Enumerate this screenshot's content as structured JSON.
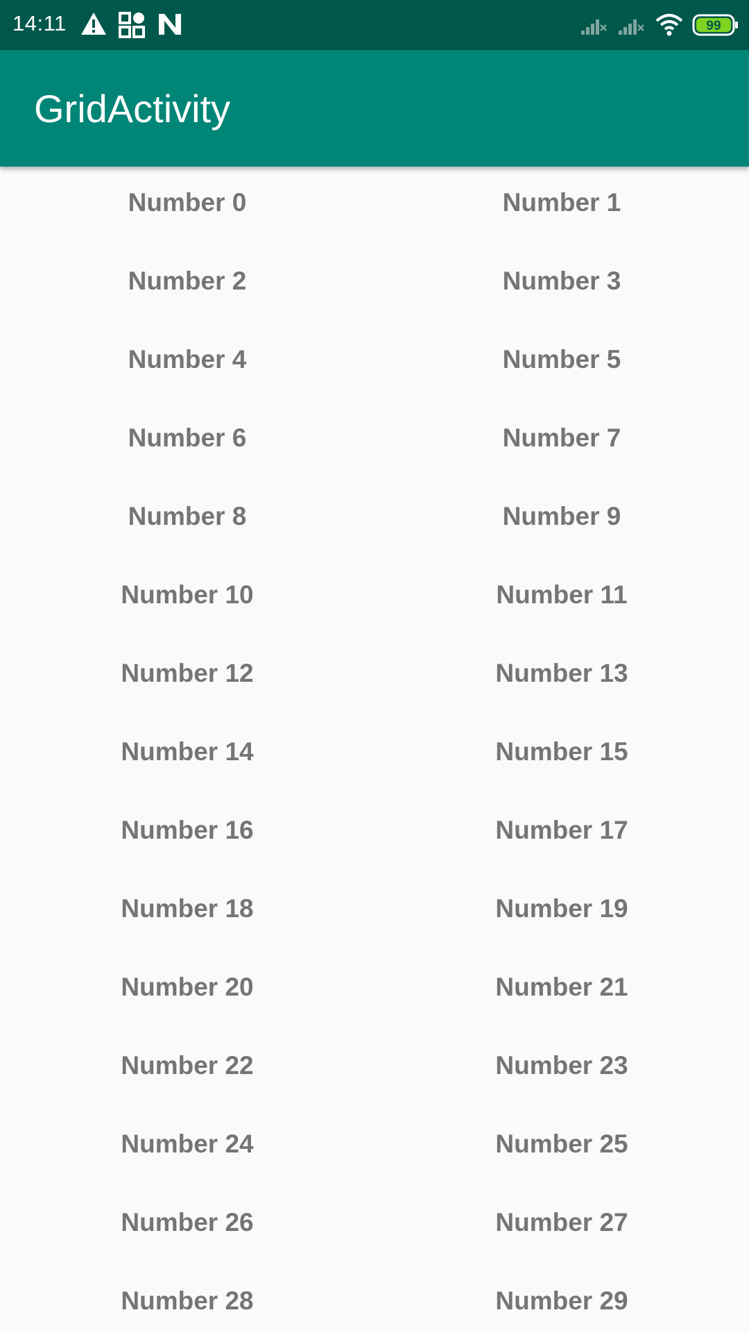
{
  "status_bar": {
    "time": "14:11",
    "left_icons": [
      "warning-icon",
      "apps-grid-icon",
      "n-notification-icon"
    ],
    "right_icons": [
      "signal-1-icon",
      "signal-2-icon",
      "wifi-icon",
      "battery-icon"
    ],
    "battery_level": "99",
    "battery_color": "#7ed321"
  },
  "app_bar": {
    "title": "GridActivity",
    "color": "#008577",
    "status_color": "#00574b"
  },
  "grid": {
    "rows": [
      [
        "Number 0",
        "Number 1"
      ],
      [
        "Number 2",
        "Number 3"
      ],
      [
        "Number 4",
        "Number 5"
      ],
      [
        "Number 6",
        "Number 7"
      ],
      [
        "Number 8",
        "Number 9"
      ],
      [
        "Number 10",
        "Number 11"
      ],
      [
        "Number 12",
        "Number 13"
      ],
      [
        "Number 14",
        "Number 15"
      ],
      [
        "Number 16",
        "Number 17"
      ],
      [
        "Number 18",
        "Number 19"
      ],
      [
        "Number 20",
        "Number 21"
      ],
      [
        "Number 22",
        "Number 23"
      ],
      [
        "Number 24",
        "Number 25"
      ],
      [
        "Number 26",
        "Number 27"
      ],
      [
        "Number 28",
        "Number 29"
      ]
    ]
  }
}
